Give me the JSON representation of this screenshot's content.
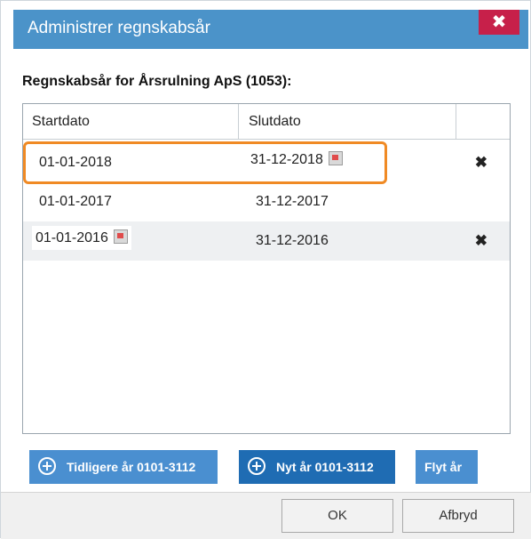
{
  "dialog": {
    "title": "Administrer regnskabsår",
    "close_label": "✖"
  },
  "heading": "Regnskabsår for Årsrulning ApS (1053):",
  "grid": {
    "columns": [
      "Startdato",
      "Slutdato",
      ""
    ],
    "rows": [
      {
        "start": "01-01-2018",
        "end": "31-12-2018",
        "deletable": true,
        "highlighted": true
      },
      {
        "start": "01-01-2017",
        "end": "31-12-2017",
        "deletable": false,
        "highlighted": false
      },
      {
        "start": "01-01-2016",
        "end": "31-12-2016",
        "deletable": true,
        "highlighted": false
      }
    ]
  },
  "buttons": {
    "previous_year": "Tidligere år 0101-3112",
    "new_year": "Nyt år 0101-3112",
    "move_year": "Flyt år",
    "ok": "OK",
    "cancel": "Afbryd"
  },
  "icons": {
    "close": "close-icon",
    "calendar": "calendar-icon",
    "delete": "delete-icon",
    "plus": "plus-circle-icon"
  },
  "colors": {
    "titlebar": "#4b93c9",
    "close": "#c7204a",
    "highlight": "#f08a24",
    "button_primary": "#1f6cb3",
    "button_secondary": "#4a8fd0"
  }
}
